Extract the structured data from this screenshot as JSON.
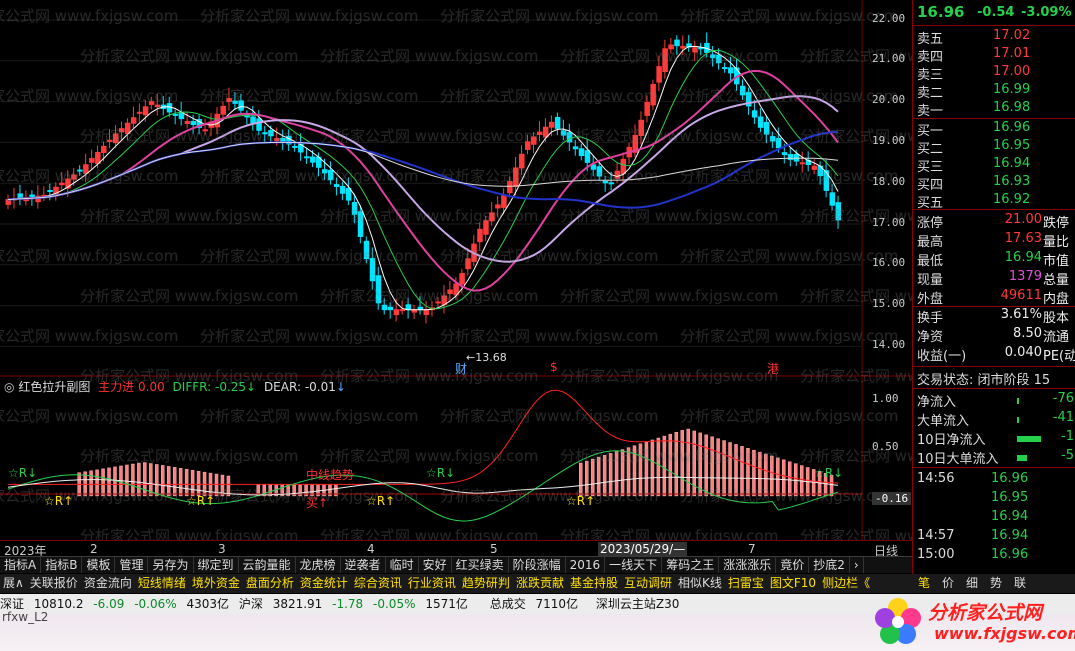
{
  "main_chart": {
    "y_axis": [
      "22.00",
      "21.00",
      "20.00",
      "19.00",
      "18.00",
      "17.00",
      "16.00",
      "15.00",
      "14.00"
    ],
    "low_marker": "13.68",
    "event_tags": [
      "财",
      "$",
      "港"
    ]
  },
  "sub_chart": {
    "title": "红色拉升副图",
    "label1": "主力进",
    "value1": "0.00",
    "label2": "DIFFR:",
    "value2": "-0.25",
    "label3": "DEAR:",
    "value3": "-0.01",
    "y_axis": [
      "1.00",
      "0.50"
    ],
    "current": "-0.16",
    "signals": [
      "☆R↓",
      "☆R↑",
      "中线趋势",
      "☆R↓",
      "☆R↑",
      "☆R↓",
      "☆R↑",
      "☆R↓",
      "买↑"
    ]
  },
  "time_axis": {
    "labels": [
      "2023年",
      "2",
      "3",
      "4",
      "5",
      "2023/05/29/—",
      "7"
    ],
    "period": "日线"
  },
  "quote": {
    "price": "16.96",
    "change": "-0.54",
    "pct": "-3.09%"
  },
  "order_book": [
    {
      "label": "卖五",
      "price": "17.02"
    },
    {
      "label": "卖四",
      "price": "17.01"
    },
    {
      "label": "卖三",
      "price": "17.00"
    },
    {
      "label": "卖二",
      "price": "16.99"
    },
    {
      "label": "卖一",
      "price": "16.98"
    },
    {
      "label": "买一",
      "price": "16.96"
    },
    {
      "label": "买二",
      "price": "16.95"
    },
    {
      "label": "买三",
      "price": "16.94"
    },
    {
      "label": "买四",
      "price": "16.93"
    },
    {
      "label": "买五",
      "price": "16.92"
    }
  ],
  "stats": [
    {
      "label": "涨停",
      "value": "21.00",
      "label2": "跌停"
    },
    {
      "label": "最高",
      "value": "17.63",
      "label2": "量比"
    },
    {
      "label": "最低",
      "value": "16.94",
      "label2": "市值"
    },
    {
      "label": "现量",
      "value": "1379",
      "label2": "总量"
    },
    {
      "label": "外盘",
      "value": "49611",
      "label2": "内盘"
    },
    {
      "label": "换手",
      "value": "3.61%",
      "label2": "股本"
    },
    {
      "label": "净资",
      "value": "8.50",
      "label2": "流通"
    },
    {
      "label": "收益(一)",
      "value": "0.040",
      "label2": "PE(动"
    }
  ],
  "trade_status": "交易状态: 闭市阶段 15",
  "flows": [
    {
      "label": "净流入",
      "value": "-76"
    },
    {
      "label": "大单流入",
      "value": "-41"
    },
    {
      "label": "10日净流入",
      "value": "-1"
    },
    {
      "label": "10日大单流入",
      "value": "-5"
    }
  ],
  "ticks": [
    {
      "time": "14:56",
      "price": "16.96"
    },
    {
      "time": "",
      "price": "16.95"
    },
    {
      "time": "",
      "price": "16.94"
    },
    {
      "time": "14:57",
      "price": "16.94"
    },
    {
      "time": "15:00",
      "price": "16.96"
    }
  ],
  "tabs1": [
    "指标A",
    "指标B",
    "模板",
    "管理",
    "另存为",
    "绑定到",
    "云韵量能",
    "龙虎榜",
    "逆袭者",
    "临时",
    "安好",
    "红买绿卖",
    "阶段涨幅",
    "2016",
    "一线天下",
    "筹码之王",
    "涨涨涨乐",
    "竟价",
    "抄底2"
  ],
  "tabs2": [
    "展∧",
    "关联报价",
    "资金流向",
    "短线情绪",
    "境外资金",
    "盘面分析",
    "资金统计",
    "综合资讯",
    "行业资讯",
    "趋势研判",
    "涨跌贡献",
    "基金持股",
    "互动调研",
    "相似K线",
    "扫雷宝",
    "图文F10",
    "侧边栏《"
  ],
  "right_tabs": [
    "笔",
    "价",
    "细",
    "势",
    "联"
  ],
  "status": {
    "idx1_name": "深证",
    "idx1_val": "10810.2",
    "idx1_chg": "-6.09",
    "idx1_pct": "-0.06%",
    "idx1_amt": "4303亿",
    "idx2_name": "沪深",
    "idx2_val": "3821.91",
    "idx2_chg": "-1.78",
    "idx2_pct": "-0.05%",
    "idx2_amt": "1571亿",
    "total_label": "总成交",
    "total_val": "7110亿",
    "server": "深圳云主站Z30"
  },
  "bottom_text": "rfxw_L2",
  "watermark": "分析家公式网 www.fxjgsw.com",
  "logo": {
    "name": "分析家公式网",
    "url": "www.fxjgsw.com"
  },
  "colors": {
    "up": "#ff3a3a",
    "down": "#00e5ff",
    "ma_pink": "#e040a0",
    "ma_lav": "#c8a8e8",
    "ma_blue": "#2233cc"
  }
}
